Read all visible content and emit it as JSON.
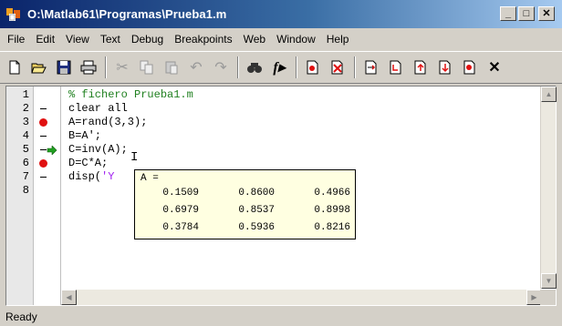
{
  "window": {
    "title": "O:\\Matlab61\\Programas\\Prueba1.m",
    "minimize_label": "_",
    "maximize_label": "□",
    "close_label": "✕"
  },
  "menu": [
    "File",
    "Edit",
    "View",
    "Text",
    "Debug",
    "Breakpoints",
    "Web",
    "Window",
    "Help"
  ],
  "toolbar": {
    "icons": [
      "new-file-icon",
      "open-file-icon",
      "save-icon",
      "print-icon",
      "cut-icon",
      "copy-icon",
      "paste-icon",
      "undo-icon",
      "redo-icon",
      "find-icon",
      "function-icon",
      "set-breakpoint-icon",
      "clear-breakpoints-icon",
      "step-icon",
      "step-in-icon",
      "step-out-icon",
      "continue-icon",
      "exit-debug-icon"
    ]
  },
  "editor": {
    "line_numbers": [
      "1",
      "2",
      "3",
      "4",
      "5",
      "6",
      "7",
      "8"
    ],
    "lines": [
      {
        "text": "% fichero Prueba1.m",
        "kind": "comment",
        "marker": "none"
      },
      {
        "text": "clear all",
        "kind": "code",
        "marker": "dash"
      },
      {
        "text": "A=rand(3,3);",
        "kind": "code",
        "marker": "breakpoint"
      },
      {
        "text": "B=A';",
        "kind": "code",
        "marker": "dash"
      },
      {
        "text": "C=inv(A);",
        "kind": "code",
        "marker": "dash",
        "current": true
      },
      {
        "text": "D=C*A;",
        "kind": "code",
        "marker": "breakpoint"
      },
      {
        "text": "disp('Y",
        "kind": "code",
        "marker": "dash"
      },
      {
        "text": "",
        "kind": "code",
        "marker": "none"
      }
    ],
    "line7_prefix": "disp(",
    "line7_string": "'Y"
  },
  "tooltip": {
    "variable": "A =",
    "rows": [
      [
        "0.1509",
        "0.8600",
        "0.4966"
      ],
      [
        "0.6979",
        "0.8537",
        "0.8998"
      ],
      [
        "0.3784",
        "0.5936",
        "0.8216"
      ]
    ]
  },
  "status": "Ready",
  "colors": {
    "comment": "#208020",
    "string": "#a020f0",
    "breakpoint": "#e01010",
    "current_arrow": "#20a020",
    "tooltip_bg": "#ffffe1"
  }
}
